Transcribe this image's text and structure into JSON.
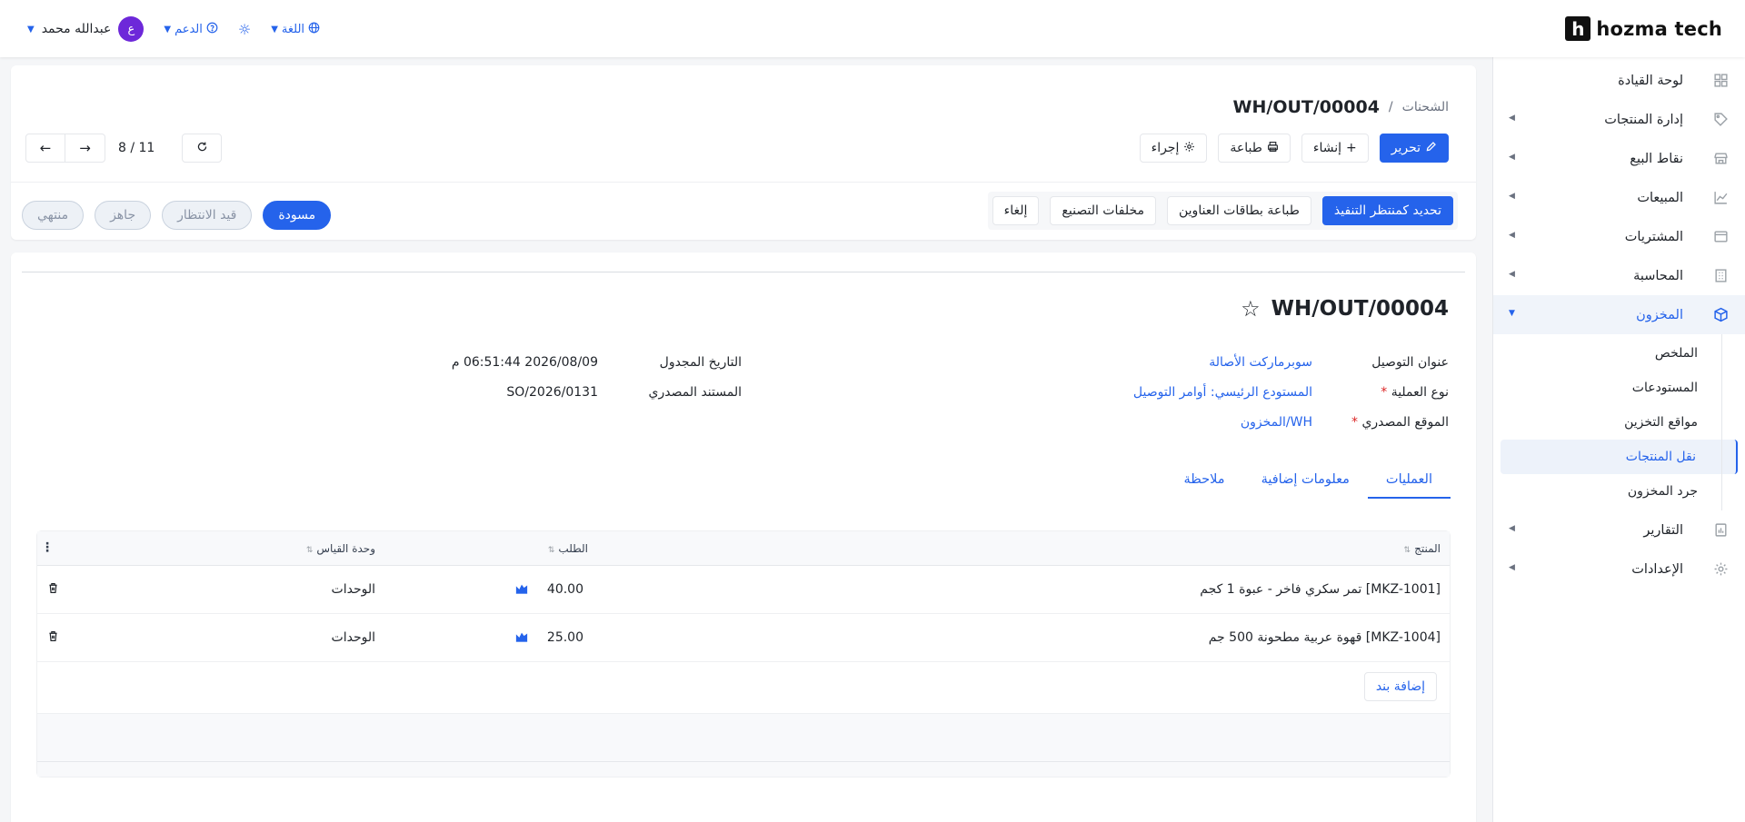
{
  "brand": {
    "mark": "h",
    "name": "hozma tech"
  },
  "topbar": {
    "user_name": "عبدالله محمد",
    "avatar_letter": "ع",
    "support_label": "الدعم",
    "language_label": "اللغة"
  },
  "sidebar": {
    "items": [
      {
        "label": "لوحة القيادة",
        "icon": "dashboard-icon",
        "has_arrow": false
      },
      {
        "label": "إدارة المنتجات",
        "icon": "tag-icon",
        "has_arrow": true
      },
      {
        "label": "نقاط البيع",
        "icon": "store-icon",
        "has_arrow": true
      },
      {
        "label": "المبيعات",
        "icon": "chart-line-icon",
        "has_arrow": true
      },
      {
        "label": "المشتريات",
        "icon": "wallet-icon",
        "has_arrow": true
      },
      {
        "label": "المحاسبة",
        "icon": "building-icon",
        "has_arrow": true
      },
      {
        "label": "المخزون",
        "icon": "box-icon",
        "has_arrow": true,
        "active": true
      }
    ],
    "sub_items": [
      {
        "label": "الملخص"
      },
      {
        "label": "المستودعات"
      },
      {
        "label": "مواقع التخزين"
      },
      {
        "label": "نقل المنتجات",
        "active": true
      },
      {
        "label": "جرد المخزون"
      }
    ],
    "bottom_items": [
      {
        "label": "التقارير",
        "icon": "report-icon",
        "has_arrow": true
      },
      {
        "label": "الإعدادات",
        "icon": "gear-icon",
        "has_arrow": true
      }
    ]
  },
  "header": {
    "breadcrumb_parent": "الشحنات",
    "breadcrumb_sep": "/",
    "breadcrumb_current": "WH/OUT/00004",
    "actions": {
      "edit": "تحرير",
      "create": "إنشاء",
      "print": "طباعة",
      "action": "إجراء"
    },
    "pager": {
      "count": "8 / 11"
    },
    "workflow": {
      "mark_todo": "تحديد كمنتظر التنفيذ",
      "print_labels": "طباعة بطاقات العناوين",
      "scrap": "مخلفات التصنيع",
      "cancel": "إلغاء"
    },
    "status": [
      "مسودة",
      "قيد الانتظار",
      "جاهز",
      "منتهي"
    ],
    "status_active": "مسودة"
  },
  "record": {
    "title": "WH/OUT/00004",
    "fields": {
      "delivery_address_label": "عنوان التوصيل",
      "delivery_address": "سوبرماركت الأصالة",
      "operation_type_label": "نوع العملية",
      "operation_type": "المستودع الرئيسي: أوامر التوصيل",
      "source_location_label": "الموقع المصدري",
      "source_location": "WH/المخزون",
      "scheduled_date_label": "التاريخ المجدول",
      "scheduled_date": "2026/08/09 06:51:44 م",
      "source_document_label": "المستند المصدري",
      "source_document": "SO/2026/0131",
      "required_mark": "*"
    },
    "tabs": [
      "العمليات",
      "معلومات إضافية",
      "ملاحظة"
    ],
    "table": {
      "columns": {
        "product": "المنتج",
        "demand": "الطلب",
        "uom": "وحدة القياس"
      },
      "rows": [
        {
          "product": "[MKZ-1001] تمر سكري فاخر - عبوة 1 كجم",
          "demand": "40.00",
          "uom": "الوحدات"
        },
        {
          "product": "[MKZ-1004] قهوة عربية مطحونة 500 جم",
          "demand": "25.00",
          "uom": "الوحدات"
        }
      ],
      "add_line": "إضافة بند"
    }
  },
  "colors": {
    "accent": "#2563eb",
    "avatar": "#6d28d9"
  }
}
